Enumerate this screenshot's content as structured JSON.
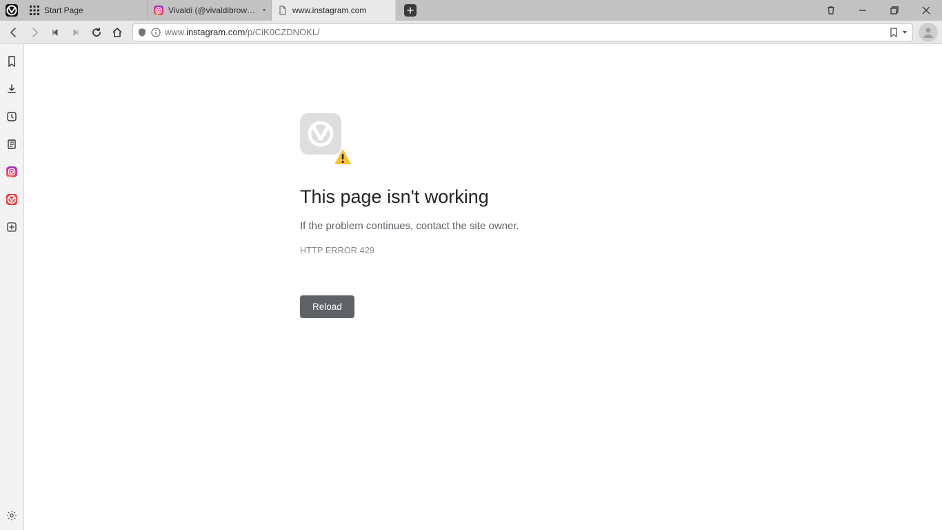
{
  "tabs": [
    {
      "label": "Start Page",
      "icon": "grid"
    },
    {
      "label": "Vivaldi (@vivaldibrowser)",
      "icon": "instagram",
      "modified": "•"
    },
    {
      "label": "www.instagram.com",
      "icon": "page",
      "active": true
    }
  ],
  "addressbar": {
    "url_prefix": "www.",
    "url_bold": "instagram.com",
    "url_suffix": "/p/CiK0CZDNOKL/"
  },
  "error": {
    "title": "This page isn't working",
    "message": "If the problem continues, contact the site owner.",
    "code": "HTTP ERROR 429",
    "reload_label": "Reload"
  }
}
